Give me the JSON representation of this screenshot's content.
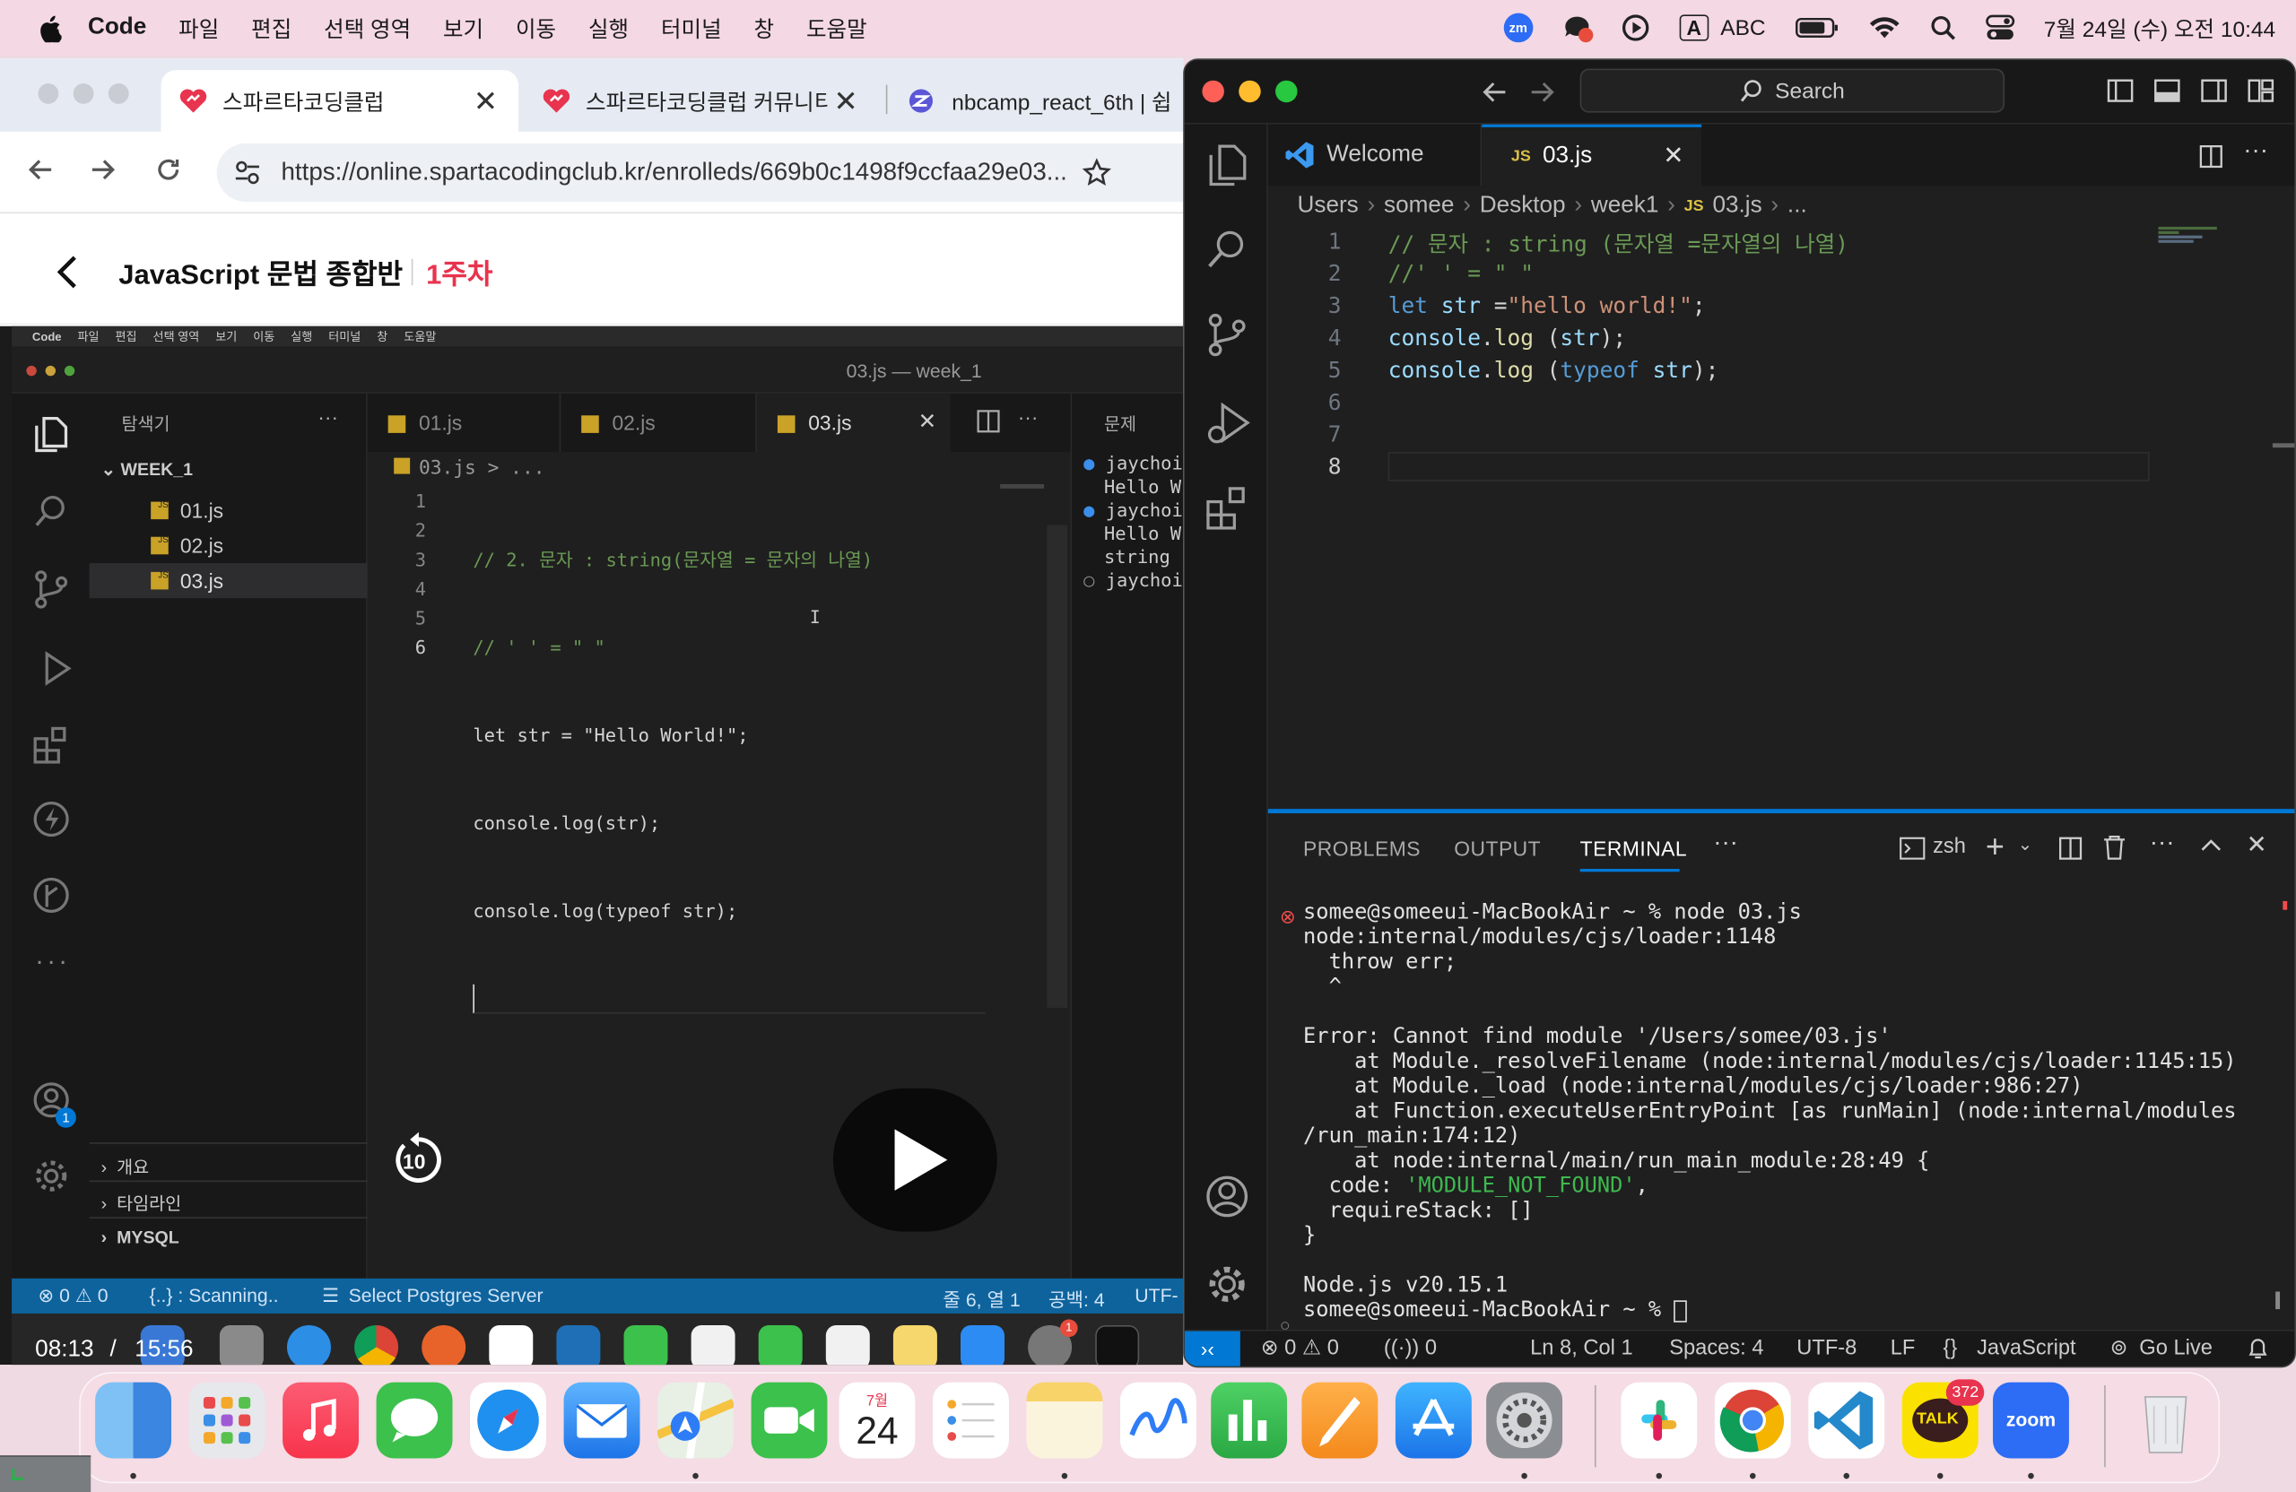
{
  "menubar": {
    "app": "Code",
    "items": [
      "파일",
      "편집",
      "선택 영역",
      "보기",
      "이동",
      "실행",
      "터미널",
      "창",
      "도움말"
    ],
    "input_label": "A",
    "input_source": "ABC",
    "datetime": "7월 24일 (수) 오전 10:44"
  },
  "browser": {
    "tabs": [
      "스파르타코딩클럽",
      "스파르타코딩클럽 커뮤니티",
      "nbcamp_react_6th | 쉽"
    ],
    "url": "https://online.spartacodingclub.kr/enrolleds/669b0c1498f9ccfaa29e03...",
    "course_title": "JavaScript 문법 종합반",
    "week": "1주차"
  },
  "video": {
    "current_time": "08:13",
    "separator": "/",
    "duration": "15:56",
    "progress": 0.516,
    "skip_label": "10",
    "inner_menubar": [
      "Code",
      "파일",
      "편집",
      "선택 영역",
      "보기",
      "이동",
      "실행",
      "터미널",
      "창",
      "도움말"
    ],
    "inner_title": "03.js — week_1",
    "explorer_title": "탐색기",
    "folder": "WEEK_1",
    "files": [
      "01.js",
      "02.js",
      "03.js"
    ],
    "tabs": [
      "01.js",
      "02.js",
      "03.js"
    ],
    "breadcrumb": "03.js > ...",
    "line_numbers": [
      "1",
      "2",
      "3",
      "4",
      "5",
      "6"
    ],
    "code": [
      "// 2. 문자 : string(문자열 = 문자의 나열)",
      "// ' ' = \" \"",
      "let str = \"Hello World!\";",
      "console.log(str);",
      "console.log(typeof str);",
      ""
    ],
    "panel_title": "문제",
    "terminal_snippets": [
      "jaychoi",
      "Hello W",
      "jaychoi",
      "Hello W",
      "string",
      "jaychoi"
    ],
    "sections": [
      "개요",
      "타임라인",
      "MYSQL"
    ],
    "status_left": "⊗ 0 ⚠ 0",
    "status_scan": "{..} : Scanning..",
    "status_pg": "Select Postgres Server",
    "status_pos": "줄 6, 열 1",
    "status_spaces": "공백: 4",
    "status_enc": "UTF-",
    "account_badge": "1",
    "settings_badge": "1"
  },
  "vscode": {
    "search_placeholder": "Search",
    "tabs": [
      {
        "label": "Welcome"
      },
      {
        "label": "03.js",
        "icon": "JS"
      }
    ],
    "breadcrumb": [
      "Users",
      "somee",
      "Desktop",
      "week1",
      "03.js",
      "..."
    ],
    "line_numbers": [
      "1",
      "2",
      "3",
      "4",
      "5",
      "6",
      "7",
      "8"
    ],
    "active_line": "8",
    "code": [
      "// 문자 : string (문자열 =문자열의 나열)",
      "//' ' = \" \"",
      "let str =\"hello world!\";",
      "console.log (str);",
      "console.log (typeof str);",
      "",
      "",
      ""
    ],
    "panel_tabs": [
      "PROBLEMS",
      "OUTPUT",
      "TERMINAL"
    ],
    "shell": "zsh",
    "terminal": [
      "somee@someeui-MacBookAir ~ % node 03.js",
      "node:internal/modules/cjs/loader:1148",
      "  throw err;",
      "  ^",
      "",
      "Error: Cannot find module '/Users/somee/03.js'",
      "    at Module._resolveFilename (node:internal/modules/cjs/loader:1145:15)",
      "    at Module._load (node:internal/modules/cjs/loader:986:27)",
      "    at Function.executeUserEntryPoint [as runMain] (node:internal/modules",
      "/run_main:174:12)",
      "    at node:internal/main/run_main_module:28:49 {",
      "  code: 'MODULE_NOT_FOUND',",
      "  requireStack: []",
      "}",
      "",
      "Node.js v20.15.1",
      "somee@someeui-MacBookAir ~ % "
    ],
    "status": {
      "errors": "0",
      "warnings": "0",
      "ports": "0",
      "position": "Ln 8, Col 1",
      "spaces": "Spaces: 4",
      "encoding": "UTF-8",
      "eol": "LF",
      "language": "JavaScript",
      "golive": "Go Live"
    }
  },
  "dock": {
    "calendar_month": "7월",
    "calendar_day": "24",
    "kakao_badge": "372",
    "kakao_label": "TALK",
    "zoom_label": "zoom",
    "zm_label": "zm"
  },
  "colors": {
    "accent": "#0078d4",
    "brand_red": "#e8344e",
    "code_comment": "#6a9955",
    "code_string": "#ce9178",
    "code_keyword": "#569cd6"
  }
}
